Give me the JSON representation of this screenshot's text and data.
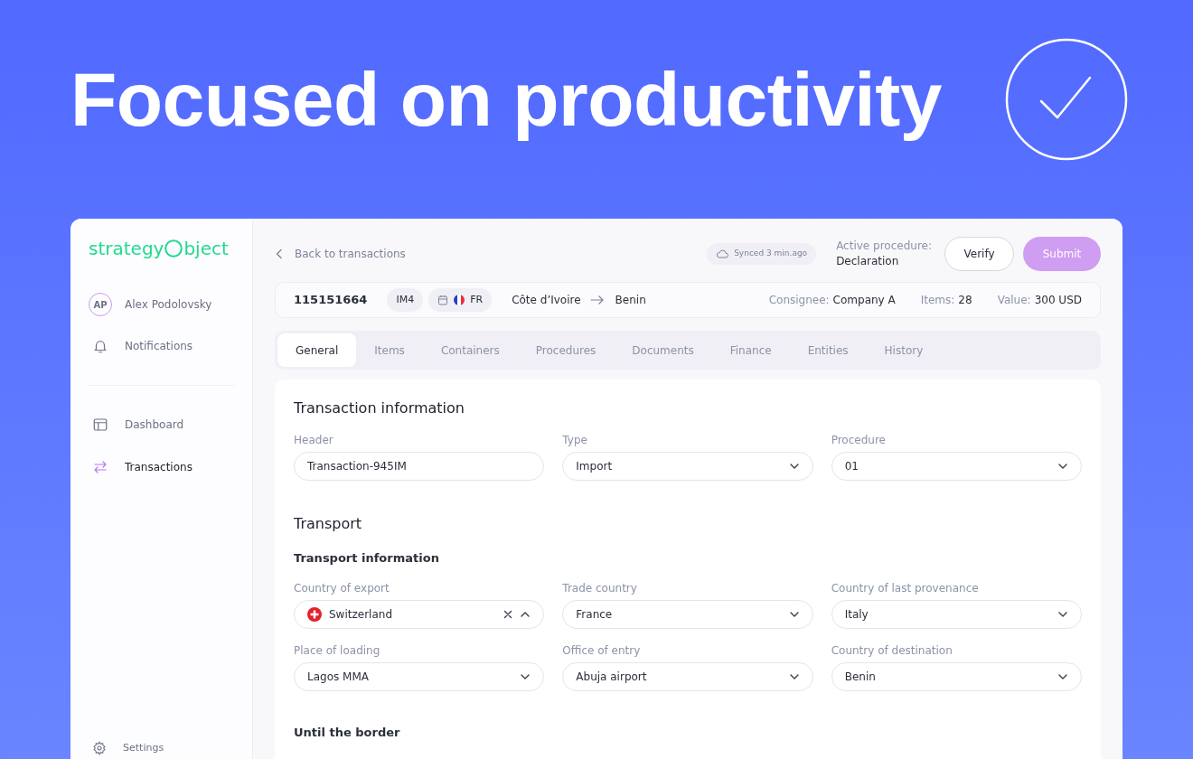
{
  "headline": "Focused on productivity",
  "logo": {
    "start": "strategy",
    "end": "bject"
  },
  "user": {
    "initials": "AP",
    "name": "Alex Podolovsky"
  },
  "top_items": [
    {
      "label": "Notifications",
      "kind": "bell"
    }
  ],
  "nav": [
    {
      "label": "Dashboard",
      "kind": "layout",
      "selected": false
    },
    {
      "label": "Transactions",
      "kind": "arrows",
      "selected": true
    }
  ],
  "settings": {
    "label": "Settings"
  },
  "topbar": {
    "back": "Back to transactions",
    "sync": "Synced 3 min.ago",
    "procedure_label": "Active procedure:",
    "procedure_value": "Declaration",
    "buttons": [
      {
        "label": "Verify",
        "kind": "outline"
      },
      {
        "label": "Submit",
        "kind": "primary"
      }
    ]
  },
  "summary": {
    "id": "115151664",
    "badges": [
      {
        "label": "IM4",
        "kind": "plain"
      },
      {
        "label": "FR",
        "kind": "flag"
      }
    ],
    "from": "Côte d’Ivoire",
    "to": "Benin",
    "stats": [
      {
        "label": "Consignee:",
        "value": "Company A"
      },
      {
        "label": "Items:",
        "value": "28"
      },
      {
        "label": "Value:",
        "value": "300 USD"
      }
    ]
  },
  "tabs": [
    {
      "label": "General",
      "selected": true
    },
    {
      "label": "Items",
      "selected": false
    },
    {
      "label": "Containers",
      "selected": false
    },
    {
      "label": "Procedures",
      "selected": false
    },
    {
      "label": "Documents",
      "selected": false
    },
    {
      "label": "Finance",
      "selected": false
    },
    {
      "label": "Entities",
      "selected": false
    },
    {
      "label": "History",
      "selected": false
    }
  ],
  "form": [
    {
      "kind": "heading",
      "text": "Transaction information"
    },
    {
      "kind": "fields",
      "fields": [
        {
          "label": "Header",
          "value": "Transaction-945IM",
          "kind": "text"
        },
        {
          "label": "Type",
          "value": "Import",
          "kind": "select",
          "expanded": false
        },
        {
          "label": "Procedure",
          "value": "01",
          "kind": "select",
          "expanded": false
        }
      ]
    },
    {
      "kind": "heading",
      "text": "Transport"
    },
    {
      "kind": "subheading",
      "text": "Transport information"
    },
    {
      "kind": "fields",
      "fields": [
        {
          "label": "Country of export",
          "value": "Switzerland",
          "kind": "country",
          "expanded": true
        },
        {
          "label": "Trade country",
          "value": "France",
          "kind": "select",
          "expanded": false
        },
        {
          "label": "Country of last provenance",
          "value": "Italy",
          "kind": "select",
          "expanded": false
        },
        {
          "label": "Place of loading",
          "value": "Lagos MMA",
          "kind": "select",
          "expanded": false
        },
        {
          "label": "Office of entry",
          "value": "Abuja airport",
          "kind": "select",
          "expanded": false
        },
        {
          "label": "Country of destination",
          "value": "Benin",
          "kind": "select",
          "expanded": false
        }
      ]
    },
    {
      "kind": "subheading",
      "text": "Until the border"
    }
  ]
}
